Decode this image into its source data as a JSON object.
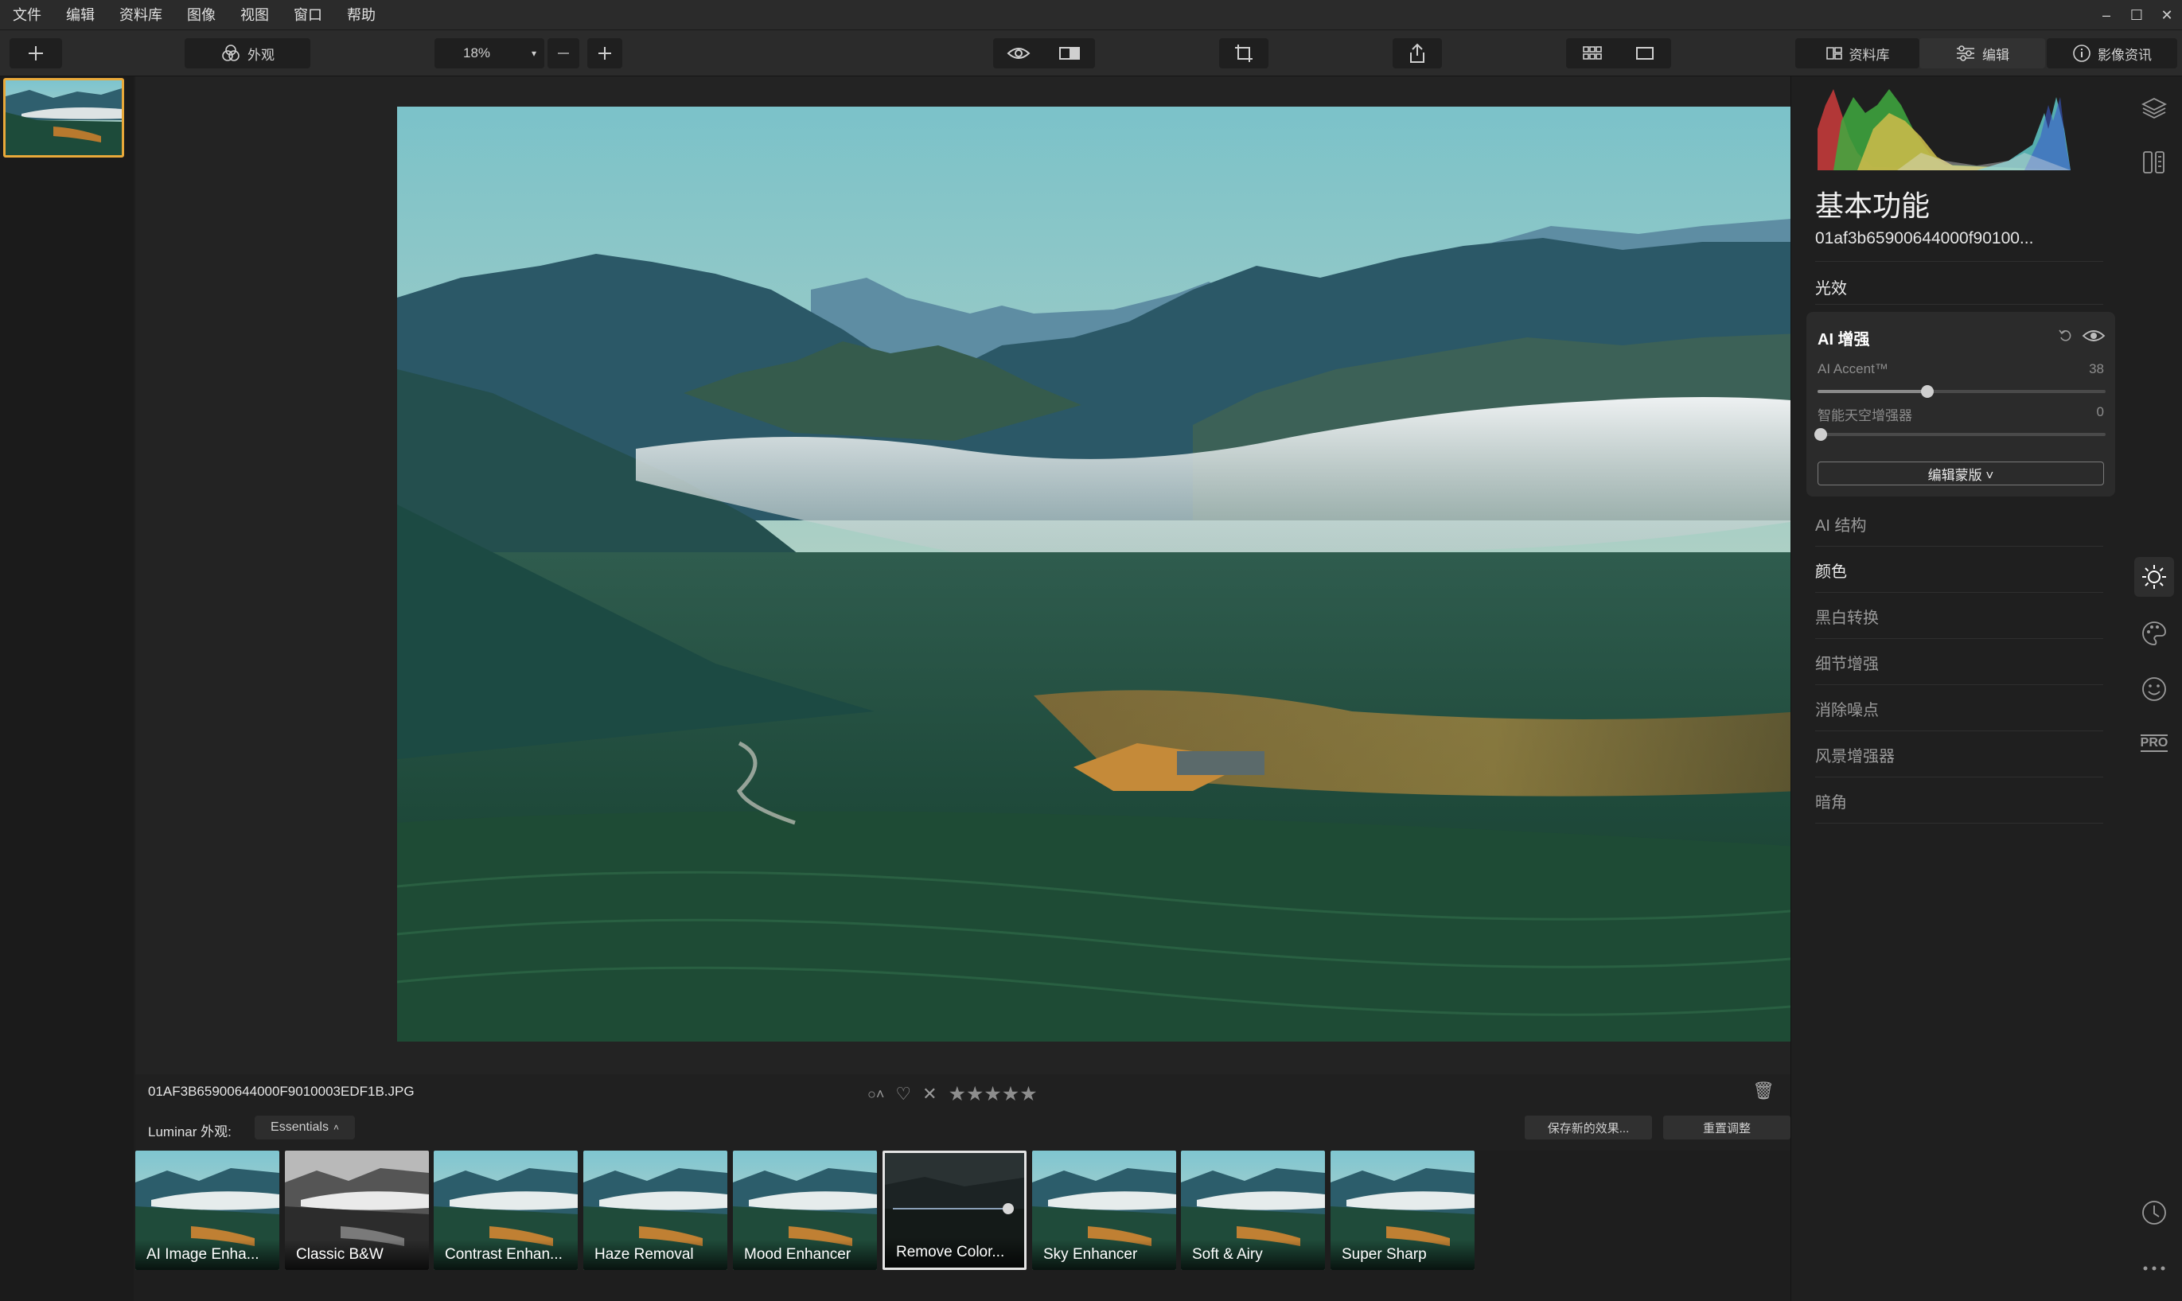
{
  "menu": [
    "文件",
    "编辑",
    "资料库",
    "图像",
    "视图",
    "窗口",
    "帮助"
  ],
  "window_controls": [
    "–",
    "☐",
    "✕"
  ],
  "toolbar": {
    "looks_label": "外观",
    "zoom": "18%",
    "library_tab": "资料库",
    "edit_tab": "编辑",
    "info_tab": "影像资讯"
  },
  "info": {
    "filename": "01AF3B65900644000F9010003EDF1B.JPG",
    "stars": "★★★★★",
    "looks_label": "Luminar 外观:",
    "looks_collection": "Essentials",
    "save_btn": "保存新的效果...",
    "reset_btn": "重置调整"
  },
  "looks": [
    {
      "name": "AI Image Enha...",
      "style": "normal"
    },
    {
      "name": "Classic B&W",
      "style": "bw"
    },
    {
      "name": "Contrast Enhan...",
      "style": "normal"
    },
    {
      "name": "Haze Removal",
      "style": "normal"
    },
    {
      "name": "Mood Enhancer",
      "style": "normal"
    },
    {
      "name": "Remove Color...",
      "style": "dark",
      "active": true
    },
    {
      "name": "Sky Enhancer",
      "style": "normal"
    },
    {
      "name": "Soft & Airy",
      "style": "normal"
    },
    {
      "name": "Super Sharp",
      "style": "normal"
    }
  ],
  "panel": {
    "title": "基本功能",
    "file": "01af3b65900644000f90100...",
    "light": "光效",
    "ai_card": {
      "title": "AI 增强",
      "accent_label": "AI Accent™",
      "accent_value": "38",
      "sky_label": "智能天空增强器",
      "sky_value": "0",
      "mask_btn": "编辑蒙版 ˅"
    },
    "sections": [
      "AI 结构",
      "颜色",
      "黑白转换",
      "细节增强",
      "消除噪点",
      "风景增强器",
      "暗角"
    ]
  },
  "side_icons": {
    "pro_label": "PRO"
  }
}
